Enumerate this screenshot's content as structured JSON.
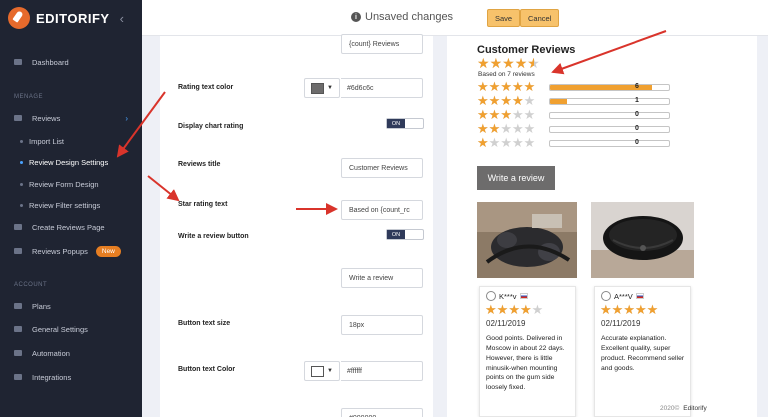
{
  "brand": {
    "name": "EDITORIFY",
    "collapse_glyph": "‹"
  },
  "topbar": {
    "unsaved": "Unsaved changes",
    "save_label": "Save",
    "cancel_label": "Cancel"
  },
  "sidebar": {
    "dashboard": "Dashboard",
    "section_manage": "MENAGE",
    "reviews": "Reviews",
    "import_list": "Import List",
    "review_design": "Review Design Settings",
    "review_form": "Review Form Design",
    "review_filter": "Review Filter settings",
    "create_page": "Create Reviews Page",
    "popups": "Reviews Popups",
    "new_badge": "New",
    "section_account": "ACCOUNT",
    "plans": "Plans",
    "general": "General Settings",
    "automation": "Automation",
    "integrations": "Integrations"
  },
  "settings": {
    "count_reviews_value": "{count} Reviews",
    "rating_text_color_label": "Rating text color",
    "rating_text_color_value": "#6d6c6c",
    "display_chart_label": "Display chart rating",
    "display_chart_toggle": "ON",
    "reviews_title_label": "Reviews title",
    "reviews_title_value": "Customer Reviews",
    "star_rating_text_label": "Star rating text",
    "star_rating_text_value": "Based on {count_rc",
    "write_review_button_label": "Write a review button",
    "write_review_toggle": "ON",
    "write_review_text_value": "Write a review",
    "button_text_size_label": "Button text size",
    "button_text_size_value": "18px",
    "button_text_color_label": "Button text Color",
    "button_text_color_value": "#ffffff",
    "last_value": "#000000"
  },
  "preview": {
    "title": "Customer Reviews",
    "average_rating": 4.5,
    "based_on": "Based on 7 reviews",
    "distribution": [
      {
        "stars": 5,
        "count": "6",
        "fraction": 0.857
      },
      {
        "stars": 4,
        "count": "1",
        "fraction": 0.143
      },
      {
        "stars": 3,
        "count": "0",
        "fraction": 0
      },
      {
        "stars": 2,
        "count": "0",
        "fraction": 0
      },
      {
        "stars": 1,
        "count": "0",
        "fraction": 0
      }
    ],
    "write_button": "Write a review",
    "reviews": [
      {
        "author": "K***v",
        "rating": 4,
        "date": "02/11/2019",
        "text": "Good points. Delivered in Moscow in about 22 days. However, there is little minusik-when mounting points on the gum side loosely fixed."
      },
      {
        "author": "A***V",
        "rating": 5,
        "date": "02/11/2019",
        "text": "Accurate explanation. Excellent quality, super product. Recommend seller and goods."
      }
    ]
  },
  "footer": {
    "year": "2020©",
    "name": "Editorify"
  },
  "colors": {
    "sidebar_bg": "#1f2432",
    "accent": "#f0a030",
    "button_gray": "#6d6c6c",
    "annotation_red": "#d9342b",
    "save_btn": "#f7c26b"
  }
}
